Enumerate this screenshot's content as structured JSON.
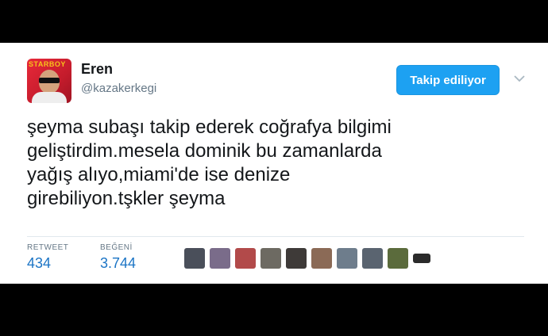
{
  "tweet": {
    "author_name": "Eren",
    "author_handle": "@kazakerkegi",
    "avatar_text": "STARBOY",
    "follow_label": "Takip ediliyor",
    "text_lines": [
      "şeyma subaşı takip ederek coğrafya bilgimi",
      "geliştirdim.mesela dominik bu zamanlarda",
      "yağış alıyo,miami'de ise denize",
      "girebiliyon.tşkler şeyma"
    ],
    "retweet_label": "RETWEET",
    "retweet_count": "434",
    "like_label": "BEĞENİ",
    "like_count": "3.744",
    "likers": [
      {
        "color": "#4a4f5a"
      },
      {
        "color": "#7a6c8a"
      },
      {
        "color": "#b24a4a"
      },
      {
        "color": "#6d6a62"
      },
      {
        "color": "#3e3a38"
      },
      {
        "color": "#8b6a56"
      },
      {
        "color": "#6e7d8c"
      },
      {
        "color": "#5a6470"
      },
      {
        "color": "#5b6b3c"
      },
      {
        "color": "#2b2b2b"
      }
    ]
  }
}
